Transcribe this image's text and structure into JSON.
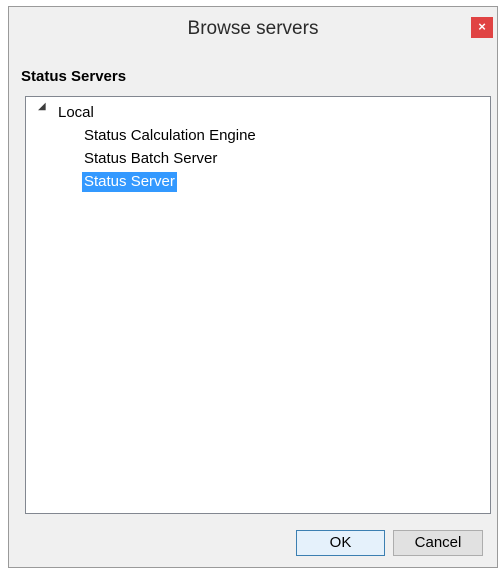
{
  "window": {
    "title": "Browse servers",
    "close_icon": "close-icon",
    "close_glyph": "×",
    "close_color": "#e04343"
  },
  "section": {
    "label": "Status Servers"
  },
  "tree": {
    "expander_icon": "triangle-expanded-icon",
    "expander_glyph": "◢",
    "root": "Local",
    "children": [
      "Status Calculation Engine",
      "Status Batch Server",
      "Status Server"
    ],
    "selected_index": 2,
    "selection_color": "#3399ff"
  },
  "buttons": {
    "ok": "OK",
    "cancel": "Cancel"
  }
}
